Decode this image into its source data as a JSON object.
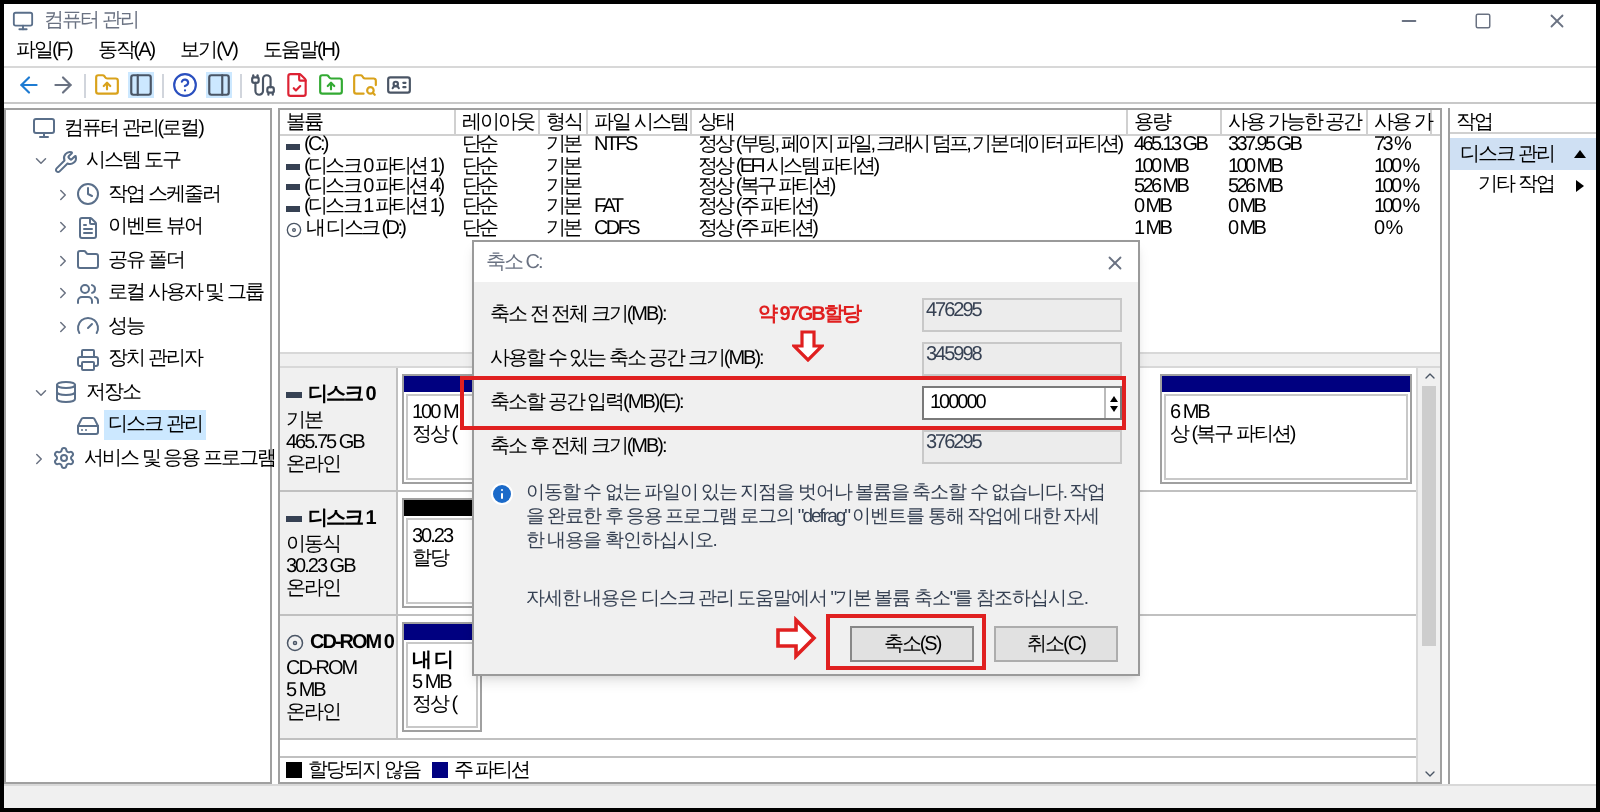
{
  "window": {
    "title": "컴퓨터 관리"
  },
  "menu": [
    "파일(F)",
    "동작(A)",
    "보기(V)",
    "도움말(H)"
  ],
  "tree": [
    {
      "label": "컴퓨터 관리(로컬)",
      "selected": false,
      "children": [
        {
          "label": "시스템 도구",
          "selected": false,
          "expanded": true,
          "children": [
            {
              "label": "작업 스케줄러",
              "selected": false,
              "expanded": false
            },
            {
              "label": "이벤트 뷰어",
              "selected": false,
              "expanded": false
            },
            {
              "label": "공유 폴더",
              "selected": false,
              "expanded": false
            },
            {
              "label": "로컬 사용자 및 그룹",
              "selected": false,
              "expanded": false
            },
            {
              "label": "성능",
              "selected": false,
              "expanded": false
            },
            {
              "label": "장치 관리자",
              "selected": false
            }
          ]
        },
        {
          "label": "저장소",
          "selected": false,
          "expanded": true,
          "children": [
            {
              "label": "디스크 관리",
              "selected": true
            }
          ]
        },
        {
          "label": "서비스 및 응용 프로그램",
          "selected": false,
          "expanded": false
        }
      ]
    }
  ],
  "table": {
    "columns": [
      "볼륨",
      "레이아웃",
      "형식",
      "파일 시스템",
      "상태",
      "용량",
      "사용 가능한 공간",
      "사용 가"
    ],
    "rows": [
      {
        "kind": "disk",
        "cells": [
          "(C:)",
          "단순",
          "기본",
          "NTFS",
          "정상 (부팅, 페이지 파일, 크래시 덤프, 기본 데이터 파티션)",
          "465.13 GB",
          "337.95 GB",
          "73 %"
        ]
      },
      {
        "kind": "disk",
        "cells": [
          "(디스크 0 파티션 1)",
          "단순",
          "기본",
          "",
          "정상 (EFI 시스템 파티션)",
          "100 MB",
          "100 MB",
          "100 %"
        ]
      },
      {
        "kind": "disk",
        "cells": [
          "(디스크 0 파티션 4)",
          "단순",
          "기본",
          "",
          "정상 (복구 파티션)",
          "526 MB",
          "526 MB",
          "100 %"
        ]
      },
      {
        "kind": "disk",
        "cells": [
          "(디스크 1 파티션 1)",
          "단순",
          "기본",
          "FAT",
          "정상 (주 파티션)",
          "0 MB",
          "0 MB",
          "100 %"
        ]
      },
      {
        "kind": "cdrom",
        "cells": [
          "내 디스크 (D:)",
          "단순",
          "기본",
          "CDFS",
          "정상 (주 파티션)",
          "1 MB",
          "0 MB",
          "0 %"
        ]
      }
    ]
  },
  "disks": [
    {
      "kind": "disk",
      "name": "디스크 0",
      "type": "기본",
      "size": "465.75 GB",
      "status": "온라인",
      "partitions": [
        {
          "kind": "primary",
          "lines": [
            "100 M",
            "정상 ("
          ]
        },
        {
          "kind": "primary",
          "lines": [
            "6 MB",
            "상 (복구 파티션)"
          ]
        }
      ]
    },
    {
      "kind": "disk",
      "name": "디스크 1",
      "type": "이동식",
      "size": "30.23 GB",
      "status": "온라인",
      "partitions": [
        {
          "kind": "unallocated",
          "lines": [
            "30.23",
            "할당"
          ]
        }
      ]
    },
    {
      "kind": "cdrom",
      "name": "CD-ROM 0",
      "type": "CD-ROM",
      "size": "5 MB",
      "status": "온라인",
      "partitions": [
        {
          "kind": "primary",
          "lines": [
            "내 디",
            "5 MB",
            "정상 ("
          ]
        }
      ]
    }
  ],
  "legend": [
    {
      "label": "할당되지 않음",
      "color": "#000000"
    },
    {
      "label": "주 파티션",
      "color": "#000080"
    }
  ],
  "actions": {
    "title": "작업",
    "section": "디스크 관리",
    "items": [
      "기타 작업"
    ]
  },
  "dialog": {
    "title": "축소 C:",
    "fields": [
      {
        "kind": "readonly",
        "label": "축소 전 전체 크기(MB):",
        "value": "476295",
        "highlighted": false
      },
      {
        "kind": "readonly",
        "label": "사용할 수 있는 축소 공간 크기(MB):",
        "value": "345998",
        "highlighted": false
      },
      {
        "kind": "spin",
        "label": "축소할 공간 입력(MB)(E):",
        "value": "100000",
        "highlighted": true
      },
      {
        "kind": "readonly",
        "label": "축소 후 전체 크기(MB):",
        "value": "376295",
        "highlighted": false
      }
    ],
    "annotation": "약 97GB할당",
    "info": "이동할 수 없는 파일이 있는 지점을 벗어나 볼륨을 축소할 수 없습니다. 작업을 완료한 후 응용 프로그램 로그의 \"defrag\" 이벤트를 통해 작업에 대한 자세한 내용을 확인하십시오.",
    "help": "자세한 내용은 디스크 관리 도움말에서 \"기본 볼륨 축소\"를 참조하십시오.",
    "buttons": [
      {
        "label": "축소(S)",
        "highlighted": true
      },
      {
        "label": "취소(C)",
        "highlighted": false
      }
    ]
  }
}
